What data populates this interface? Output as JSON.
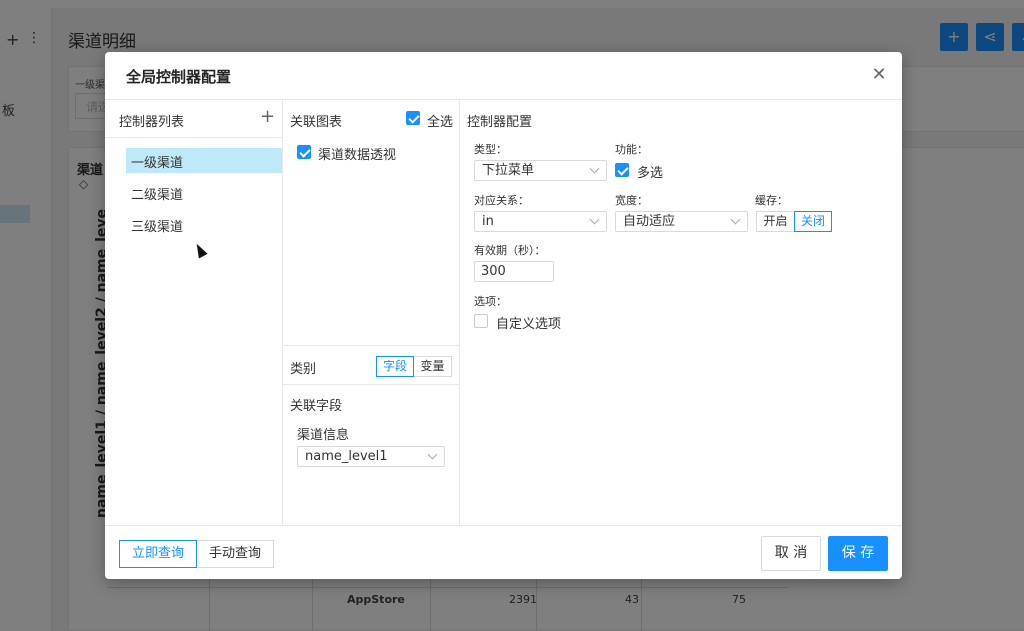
{
  "background": {
    "page_title": "渠道明细",
    "nav_plus_icon": "plus-icon",
    "nav_more_icon": "more-vertical-icon",
    "nav_fragment": "板",
    "filter_label": "一级渠",
    "filter_placeholder": "请选",
    "card_title": "渠道",
    "card_icon": "diamond-icon",
    "vertical_axis_label": "name_level1 / name_level2 / name_leve",
    "table_row": {
      "name": "AppStore",
      "v1": "2391",
      "v2": "43",
      "v3": "75"
    },
    "buttons": [
      "add-icon",
      "share-icon",
      "download-icon"
    ],
    "accent_color": "#1890ff"
  },
  "modal": {
    "title": "全局控制器配置",
    "close_icon": "close-icon",
    "controller_list": {
      "title": "控制器列表",
      "add_icon": "plus-icon",
      "items": [
        {
          "label": "一级渠道",
          "active": true
        },
        {
          "label": "二级渠道",
          "active": false
        },
        {
          "label": "三级渠道",
          "active": false
        }
      ]
    },
    "associated_charts": {
      "title": "关联图表",
      "select_all_label": "全选",
      "select_all_checked": true,
      "charts": [
        {
          "label": "渠道数据透视",
          "checked": true
        }
      ]
    },
    "category": {
      "label": "类别",
      "options": [
        "字段",
        "变量"
      ],
      "selected": "字段"
    },
    "associated_fields": {
      "title": "关联字段",
      "group_label": "渠道信息",
      "field_value": "name_level1"
    },
    "config": {
      "title": "控制器配置",
      "type_label": "类型：",
      "type_value": "下拉菜单",
      "feature_label": "功能：",
      "multi_select_label": "多选",
      "multi_select_checked": true,
      "relation_label": "对应关系：",
      "relation_value": "in",
      "width_label": "宽度：",
      "width_value": "自动适应",
      "cache_label": "缓存：",
      "cache_options": [
        "开启",
        "关闭"
      ],
      "cache_selected": "关闭",
      "validity_label": "有效期（秒）：",
      "validity_value": "300",
      "options_label": "选项：",
      "custom_option_label": "自定义选项",
      "custom_option_checked": false
    },
    "footer": {
      "query_modes": [
        "立即查询",
        "手动查询"
      ],
      "query_selected": "立即查询",
      "cancel_label": "取 消",
      "save_label": "保 存"
    }
  }
}
